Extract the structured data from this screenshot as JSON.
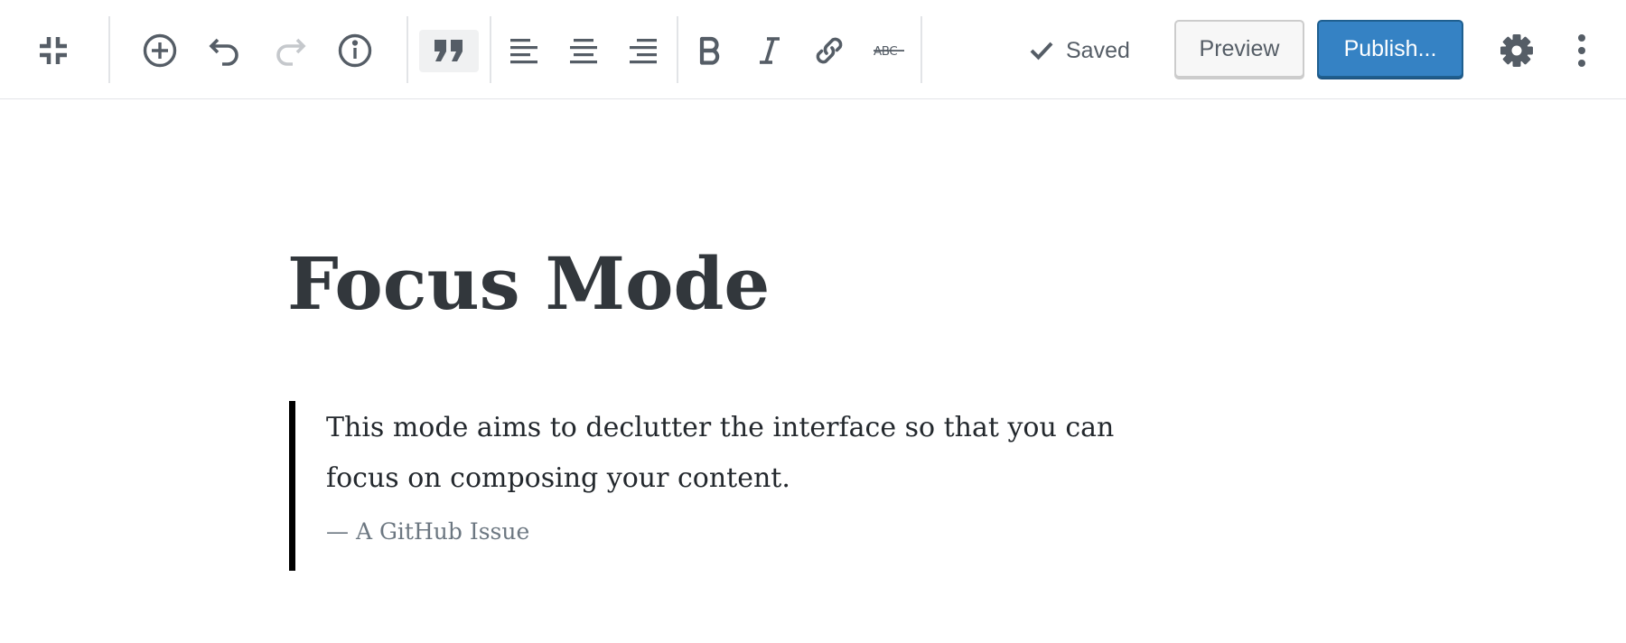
{
  "toolbar": {
    "icons": {
      "exit_fullscreen": "exit-fullscreen-icon",
      "add_block": "plus-circle-icon",
      "undo": "undo-icon",
      "redo": "redo-icon",
      "info": "info-icon",
      "quote": "quote-icon",
      "align_left": "align-left-icon",
      "align_center": "align-center-icon",
      "align_right": "align-right-icon",
      "bold": "bold-icon",
      "italic": "italic-icon",
      "link": "link-icon",
      "strikethrough": "strikethrough-icon",
      "settings": "gear-icon",
      "more": "more-vertical-icon"
    },
    "saved_label": "Saved",
    "preview_label": "Preview",
    "publish_label": "Publish..."
  },
  "post": {
    "title": "Focus Mode",
    "quote": {
      "text": "This mode aims to declutter the interface so that you can focus on composing your content.",
      "citation": "— A GitHub Issue"
    }
  },
  "colors": {
    "accent": "#3582c4",
    "text_dark": "#32373c",
    "icon": "#555d66",
    "icon_disabled": "#c5c8cc",
    "border": "#e2e4e7"
  }
}
